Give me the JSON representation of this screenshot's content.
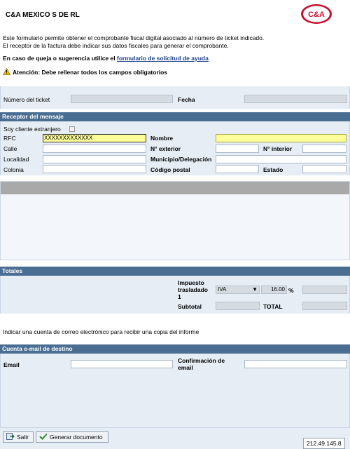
{
  "header": {
    "company": "C&A MEXICO S DE RL",
    "logo_text": "C&A",
    "intro_line1": "Este formulario permite obtener el comprobante fiscal digital asociado al número de ticket indicado.",
    "intro_line2": "El receptor de la factura debe indicar sus datos fiscales para generar el comprobante.",
    "complaint_prefix": "En caso de queja o sugerencia utilice el",
    "complaint_link": "formulario de solicitud de ayuda",
    "warning": "Atención: Debe rellenar todos los campos obligatorios"
  },
  "ticket": {
    "ticket_label": "Número del ticket",
    "ticket_value": "",
    "date_label": "Fecha",
    "date_value": ""
  },
  "receptor": {
    "title": "Receptor del mensaje",
    "foreign_label": "Soy cliente extranjero",
    "rfc_label": "RFC",
    "rfc_value": "XXXXXXXXXXXXX",
    "nombre_label": "Nombre",
    "nombre_value": "",
    "calle_label": "Calle",
    "ext_label": "N° exterior",
    "int_label": "N° interior",
    "localidad_label": "Localidad",
    "municipio_label": "Municipio/Delegación",
    "colonia_label": "Colonia",
    "cp_label": "Código postal",
    "estado_label": "Estado"
  },
  "totales": {
    "title": "Totales",
    "impuesto_label_1": "Impuesto",
    "impuesto_label_2": "trasladado",
    "impuesto_label_3": "1",
    "tax_type": "IVA",
    "tax_rate": "16.00",
    "percent_sign": "%",
    "subtotal_label": "Subtotal",
    "total_label": "TOTAL"
  },
  "email": {
    "info": "Indicar una cuenta de correo electrónico para recibir una copia del informe",
    "title": "Cuenta e-mail de destino",
    "email_label": "Email",
    "confirm_label_1": "Confirmación de",
    "confirm_label_2": "email"
  },
  "footer": {
    "exit_label": "Salir",
    "generate_label": "Generar documento",
    "ip": "212.49.145.8"
  },
  "colors": {
    "section_header": "#4a6d92",
    "panel": "#e6edf5",
    "required_field": "#ffff99",
    "link": "#1c3f8c",
    "logo_red": "#c8102e"
  }
}
